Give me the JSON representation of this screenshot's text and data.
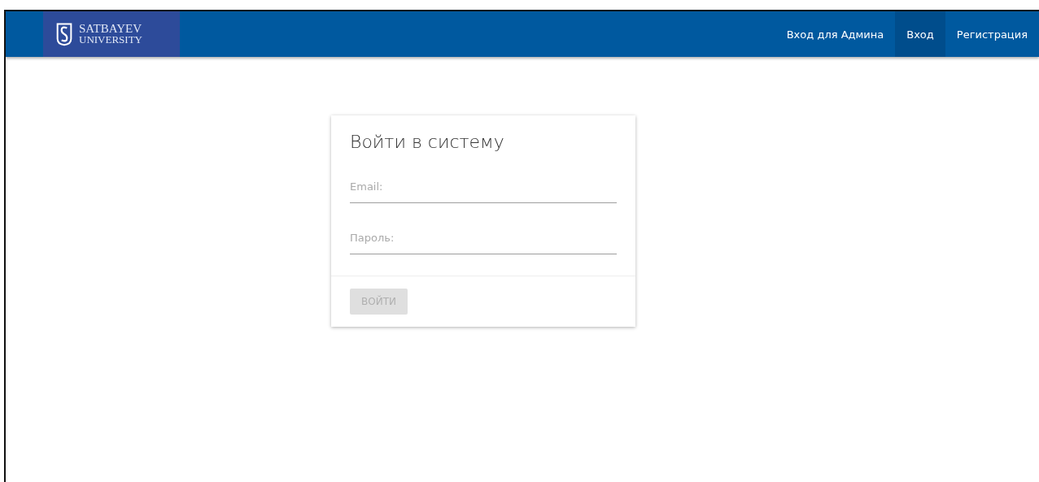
{
  "header": {
    "logo": {
      "line1": "SATBAYEV",
      "line2": "UNIVERSITY"
    },
    "nav": [
      {
        "label": "Вход для Админа",
        "selected": false
      },
      {
        "label": "Вход",
        "selected": true
      },
      {
        "label": "Регистрация",
        "selected": false
      }
    ]
  },
  "login": {
    "title": "Войти в систему",
    "fields": [
      {
        "placeholder": "Email:"
      },
      {
        "placeholder": "Пароль:"
      }
    ],
    "button": {
      "label": "ВОЙТИ",
      "disabled": true
    }
  }
}
